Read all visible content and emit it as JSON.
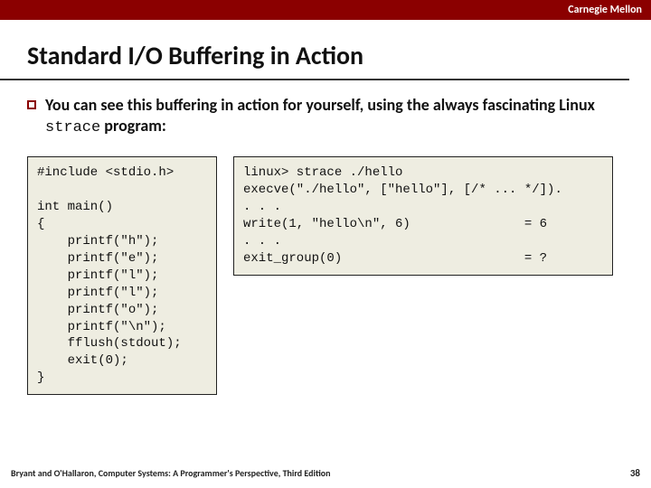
{
  "header": {
    "org": "Carnegie Mellon"
  },
  "title": "Standard I/O Buffering in Action",
  "bullet": {
    "text_pre": "You can see this buffering in action for yourself, using the always fascinating Linux ",
    "mono": "strace",
    "text_post": " program:"
  },
  "code_left": "#include <stdio.h>\n\nint main()\n{\n    printf(\"h\");\n    printf(\"e\");\n    printf(\"l\");\n    printf(\"l\");\n    printf(\"o\");\n    printf(\"\\n\");\n    fflush(stdout);\n    exit(0);\n}",
  "code_right": "linux> strace ./hello\nexecve(\"./hello\", [\"hello\"], [/* ... */]).\n. . .\nwrite(1, \"hello\\n\", 6)               = 6\n. . .\nexit_group(0)                        = ?",
  "footer": {
    "citation": "Bryant and O'Hallaron, Computer Systems: A Programmer's Perspective, Third Edition",
    "page": "38"
  }
}
